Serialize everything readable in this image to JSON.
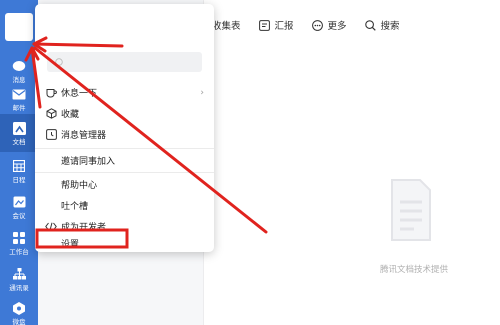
{
  "sidebar": {
    "items": [
      {
        "label": "消息",
        "icon": "message-icon"
      },
      {
        "label": "邮件",
        "icon": "mail-icon"
      },
      {
        "label": "文档",
        "icon": "docs-icon"
      },
      {
        "label": "日程",
        "icon": "calendar-icon"
      },
      {
        "label": "会议",
        "icon": "meeting-icon"
      },
      {
        "label": "工作台",
        "icon": "workbench-icon"
      },
      {
        "label": "通讯录",
        "icon": "contacts-icon"
      },
      {
        "label": "微盘",
        "icon": "drive-icon"
      }
    ],
    "active_index": 2
  },
  "toolbar": {
    "items": [
      {
        "label": "收集表",
        "icon": "form-icon"
      },
      {
        "label": "汇报",
        "icon": "report-icon"
      },
      {
        "label": "更多",
        "icon": "more-icon"
      },
      {
        "label": "搜索",
        "icon": "search-icon"
      }
    ]
  },
  "menu": {
    "items": [
      {
        "label": "休息一下",
        "icon": "coffee-icon"
      },
      {
        "label": "收藏",
        "icon": "favorite-icon"
      },
      {
        "label": "消息管理器",
        "icon": "message-manager-icon"
      },
      {
        "label": "邀请同事加入"
      },
      {
        "label": "帮助中心"
      },
      {
        "label": "吐个槽"
      },
      {
        "label": "成为开发者",
        "icon": "code-icon"
      },
      {
        "label": "设置"
      }
    ]
  },
  "main": {
    "empty_caption": "腾讯文档技术提供"
  },
  "colors": {
    "sidebar": "#3e79d6",
    "sidebar_active": "#2e63b8",
    "annotation": "#e0231e"
  }
}
